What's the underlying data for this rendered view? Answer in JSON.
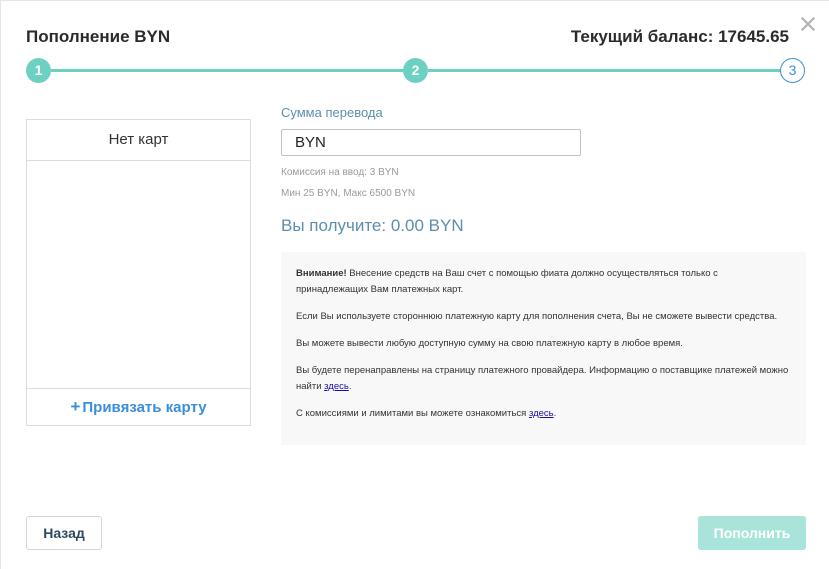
{
  "modal": {
    "title": "Пополнение BYN",
    "balance": "Текущий баланс: 17645.65",
    "close_icon": "close-icon"
  },
  "stepper": {
    "steps": [
      {
        "label": "1",
        "state": "done"
      },
      {
        "label": "2",
        "state": "done"
      },
      {
        "label": "3",
        "state": "current"
      }
    ],
    "accent": "#6cd0c2",
    "current_color": "#3c8edb"
  },
  "cards": {
    "header": "Нет карт",
    "add_plus": "+",
    "add_label": "Привязать карту"
  },
  "form": {
    "amount_label": "Сумма перевода",
    "amount_value": "BYN",
    "commission": "Комиссия на ввод: 3 BYN",
    "limits": "Мин 25 BYN, Макс 6500 BYN",
    "receive": "Вы получите: 0.00 BYN"
  },
  "notice": {
    "warning_title": "Внимание!",
    "warning_text": " Внесение средств на Ваш счет с помощью фиата должно осуществляться только с принадлежащих Вам платежных карт.",
    "p2": "Если Вы используете стороннюю платежную карту для пополнения счета, Вы не сможете вывести средства.",
    "p3": "Вы можете вывести любую доступную сумму на свою платежную карту в любое время.",
    "p4_text": "Вы будете перенаправлены на страницу платежного провайдера. Информацию о поставщике платежей можно найти ",
    "p4_link": "здесь",
    "p4_end": ".",
    "p5_text": "С комиссиями и лимитами вы можете ознакомиться ",
    "p5_link": "здесь",
    "p5_end": "."
  },
  "footer": {
    "back_label": "Назад",
    "submit_label": "Пополнить",
    "submit_color": "#a8e4da"
  }
}
